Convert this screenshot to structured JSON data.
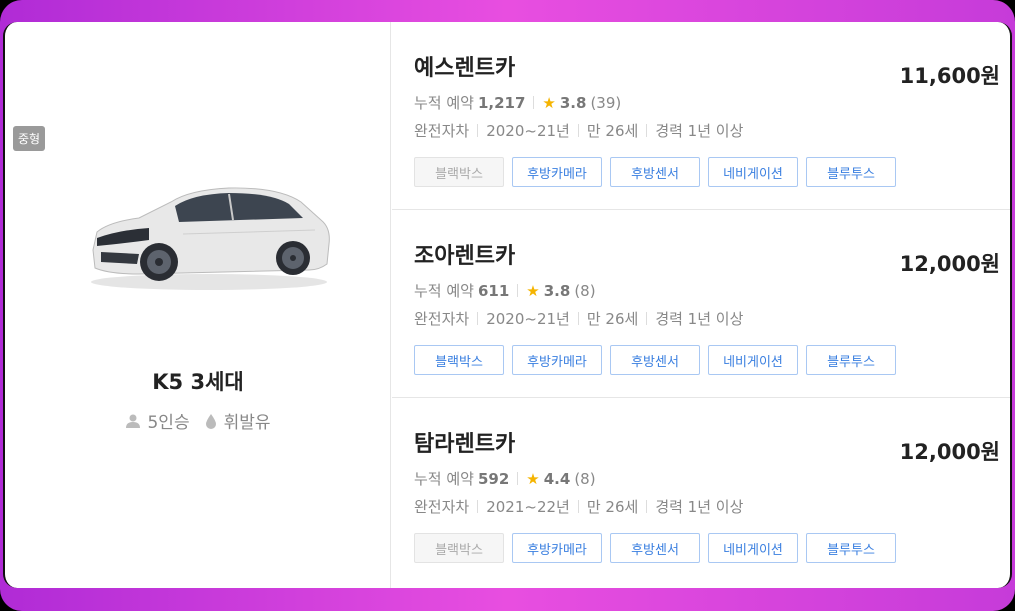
{
  "car": {
    "class_badge": "중형",
    "model": "K5 3세대",
    "seats": "5인승",
    "fuel": "휘발유",
    "seats_icon": "person-icon",
    "fuel_icon": "fuel-drop-icon",
    "color": "#e9e9e9"
  },
  "companies": [
    {
      "name": "예스렌트카",
      "price": "11,600원",
      "bookings_label": "누적 예약",
      "bookings": "1,217",
      "rating": "3.8",
      "reviews": "(39)",
      "insurance": "완전자차",
      "years": "2020~21년",
      "age": "만 26세",
      "experience": "경력 1년 이상",
      "options": [
        {
          "label": "블랙박스",
          "enabled": false
        },
        {
          "label": "후방카메라",
          "enabled": true
        },
        {
          "label": "후방센서",
          "enabled": true
        },
        {
          "label": "네비게이션",
          "enabled": true
        },
        {
          "label": "블루투스",
          "enabled": true
        }
      ]
    },
    {
      "name": "조아렌트카",
      "price": "12,000원",
      "bookings_label": "누적 예약",
      "bookings": "611",
      "rating": "3.8",
      "reviews": "(8)",
      "insurance": "완전자차",
      "years": "2020~21년",
      "age": "만 26세",
      "experience": "경력 1년 이상",
      "options": [
        {
          "label": "블랙박스",
          "enabled": true
        },
        {
          "label": "후방카메라",
          "enabled": true
        },
        {
          "label": "후방센서",
          "enabled": true
        },
        {
          "label": "네비게이션",
          "enabled": true
        },
        {
          "label": "블루투스",
          "enabled": true
        }
      ]
    },
    {
      "name": "탐라렌트카",
      "price": "12,000원",
      "bookings_label": "누적 예약",
      "bookings": "592",
      "rating": "4.4",
      "reviews": "(8)",
      "insurance": "완전자차",
      "years": "2021~22년",
      "age": "만 26세",
      "experience": "경력 1년 이상",
      "options": [
        {
          "label": "블랙박스",
          "enabled": false
        },
        {
          "label": "후방카메라",
          "enabled": true
        },
        {
          "label": "후방센서",
          "enabled": true
        },
        {
          "label": "네비게이션",
          "enabled": true
        },
        {
          "label": "블루투스",
          "enabled": true
        }
      ]
    }
  ],
  "colors": {
    "accent_blue": "#3a7fe0",
    "star": "#f5b400",
    "frame": "#d845dc"
  }
}
